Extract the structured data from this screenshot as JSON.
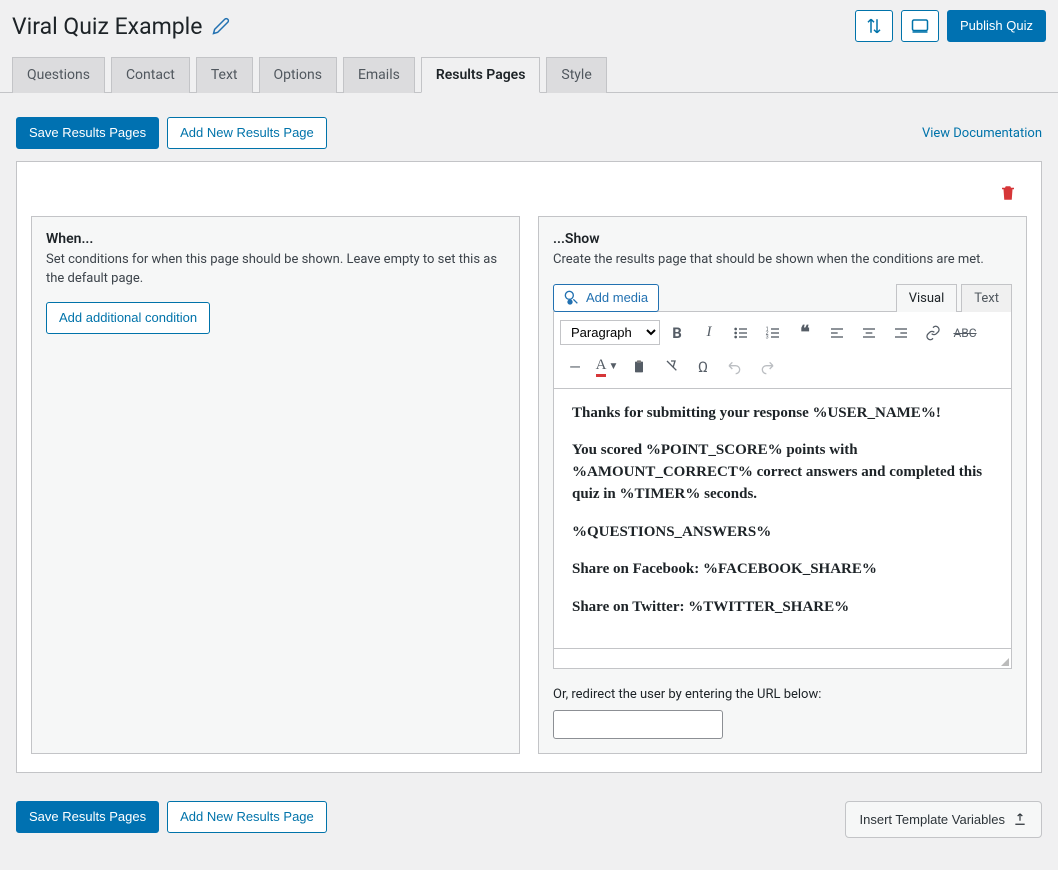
{
  "header": {
    "title": "Viral Quiz Example",
    "publish_label": "Publish Quiz"
  },
  "tabs": [
    {
      "label": "Questions"
    },
    {
      "label": "Contact"
    },
    {
      "label": "Text"
    },
    {
      "label": "Options"
    },
    {
      "label": "Emails"
    },
    {
      "label": "Results Pages",
      "active": true
    },
    {
      "label": "Style"
    }
  ],
  "actions": {
    "save_label": "Save Results Pages",
    "add_new_label": "Add New Results Page",
    "doc_link": "View Documentation"
  },
  "when_panel": {
    "title": "When...",
    "desc": "Set conditions for when this page should be shown. Leave empty to set this as the default page.",
    "add_condition_label": "Add additional condition"
  },
  "show_panel": {
    "title": "...Show",
    "desc": "Create the results page that should be shown when the conditions are met.",
    "add_media_label": "Add media",
    "format_selected": "Paragraph",
    "visual_tab": "Visual",
    "text_tab": "Text",
    "content_p1": "Thanks for submitting your response %USER_NAME%!",
    "content_p2": "You scored %POINT_SCORE% points with %AMOUNT_CORRECT% correct answers and completed this quiz in %TIMER% seconds.",
    "content_p3": "%QUESTIONS_ANSWERS%",
    "content_p4": "Share on Facebook: %FACEBOOK_SHARE%",
    "content_p5": "Share on Twitter: %TWITTER_SHARE%",
    "redirect_label": "Or, redirect the user by entering the URL below:"
  },
  "footer": {
    "template_vars_label": "Insert Template Variables"
  },
  "colors": {
    "primary": "#0073aa",
    "danger": "#d63638"
  }
}
